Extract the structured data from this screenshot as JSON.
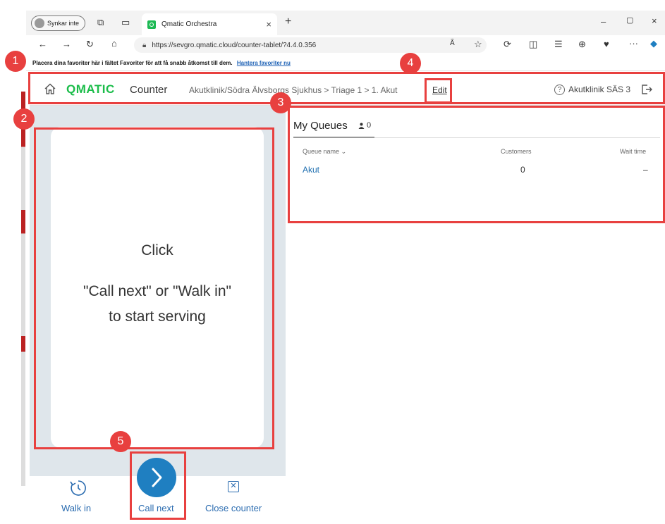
{
  "browser": {
    "profile_label": "Synkar inte",
    "tab_title": "Qmatic Orchestra",
    "tab_close": "×",
    "new_tab": "+",
    "url": "https://sevgro.qmatic.cloud/counter-tablet/?4.4.0.356",
    "favorites_hint": "Placera dina favoriter här i fältet Favoriter för att få snabb åtkomst till dem.",
    "favorites_link": "Hantera favoriter nu",
    "win_minimize": "–",
    "win_maximize": "▢",
    "win_close": "×",
    "more": "···"
  },
  "header": {
    "logo": "QMATIC",
    "product": "Counter",
    "breadcrumb": "Akutklinik/Södra Älvsborgs Sjukhus  >  Triage 1  >  1. Akut",
    "edit": "Edit",
    "branch": "Akutklinik SÄS 3"
  },
  "main": {
    "msg_line1": "Click",
    "msg_line2": "\"Call next\" or \"Walk in\"",
    "msg_line3": "to start serving"
  },
  "actions": {
    "walk_in": "Walk in",
    "call_next": "Call next",
    "close_counter": "Close counter"
  },
  "queues": {
    "title": "My Queues",
    "count": "0",
    "col_name": "Queue name",
    "col_customers": "Customers",
    "col_wait": "Wait time",
    "rows": [
      {
        "name": "Akut",
        "customers": "0",
        "wait": "–"
      }
    ]
  },
  "annotations": {
    "b1": "1",
    "b2": "2",
    "b3": "3",
    "b4": "4",
    "b5": "5"
  },
  "colors": {
    "accent": "#1f7fc1",
    "brand": "#1bbd4a",
    "annotation": "#e8403f"
  }
}
